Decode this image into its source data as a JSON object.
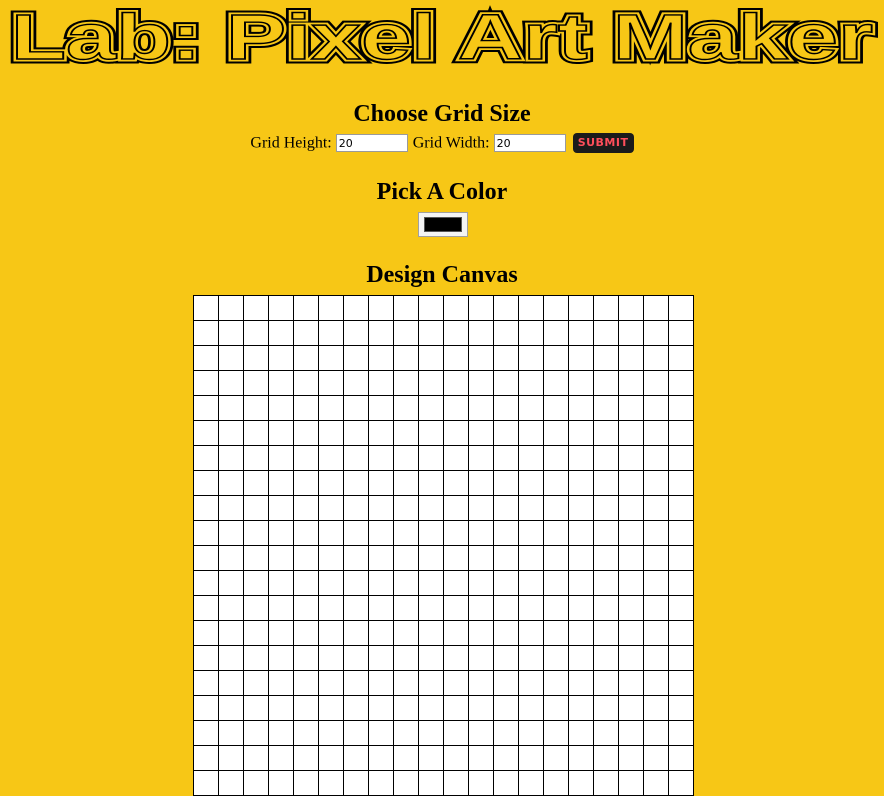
{
  "page": {
    "title": "Lab: Pixel Art Maker",
    "background": "#f7c716"
  },
  "grid_size": {
    "heading": "Choose Grid Size",
    "height_label": "Grid Height:",
    "height_value": "20",
    "width_label": "Grid Width:",
    "width_value": "20",
    "submit_label": "SUBMIT",
    "submit_text_color": "#ff4e5b",
    "submit_bg_color": "#1b1b1b"
  },
  "color": {
    "heading": "Pick A Color",
    "value": "#000000"
  },
  "canvas": {
    "heading": "Design Canvas",
    "rows": 20,
    "columns": 20,
    "cell_color": "#ffffff",
    "line_color": "#000000"
  }
}
